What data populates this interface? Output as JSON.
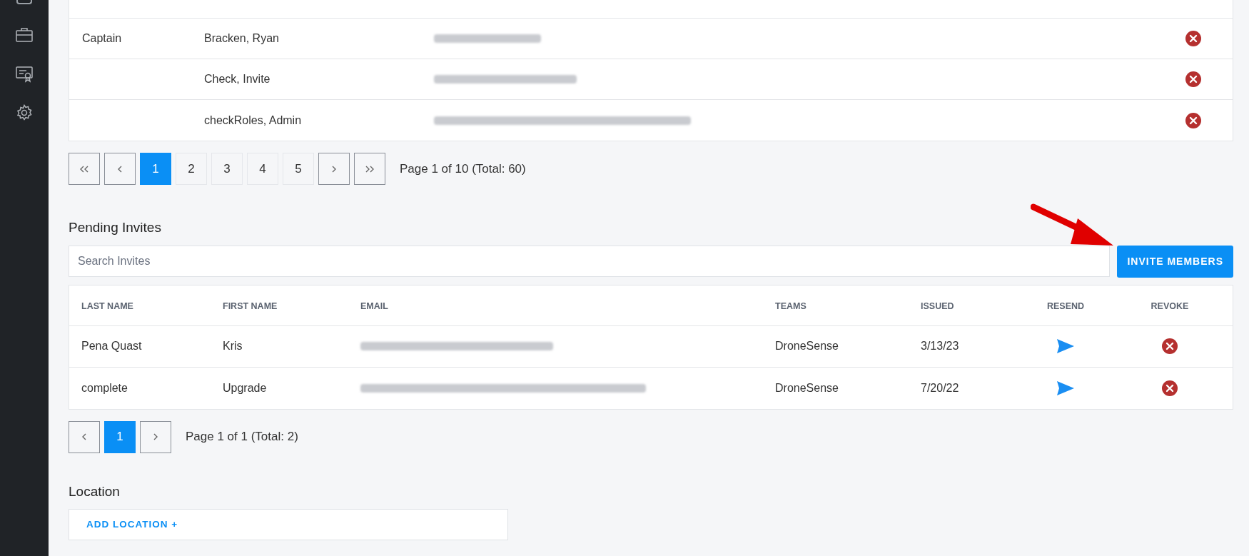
{
  "members": {
    "rows": [
      {
        "role": "",
        "name": ""
      },
      {
        "role": "Captain",
        "name": "Bracken, Ryan"
      },
      {
        "role": "",
        "name": "Check, Invite"
      },
      {
        "role": "",
        "name": "checkRoles, Admin"
      }
    ],
    "pagination": {
      "pages": [
        {
          "label": "1",
          "selected": true
        },
        {
          "label": "2",
          "selected": false
        },
        {
          "label": "3",
          "selected": false
        },
        {
          "label": "4",
          "selected": false
        },
        {
          "label": "5",
          "selected": false
        }
      ],
      "summary": "Page 1 of 10 (Total: 60)"
    }
  },
  "pending_invites": {
    "title": "Pending Invites",
    "search": {
      "placeholder": "Search Invites"
    },
    "invite_button": "INVITE MEMBERS",
    "columns": [
      "LAST NAME",
      "FIRST NAME",
      "EMAIL",
      "TEAMS",
      "ISSUED",
      "RESEND",
      "REVOKE"
    ],
    "rows": [
      {
        "last_name": "Pena Quast",
        "first_name": "Kris",
        "teams": "DroneSense",
        "issued": "3/13/23"
      },
      {
        "last_name": "complete",
        "first_name": "Upgrade",
        "teams": "DroneSense",
        "issued": "7/20/22"
      }
    ],
    "pagination": {
      "pages": [
        {
          "label": "1",
          "selected": true
        }
      ],
      "summary": "Page 1 of 1 (Total: 2)"
    }
  },
  "location": {
    "title": "Location",
    "add_button": "ADD LOCATION +"
  }
}
